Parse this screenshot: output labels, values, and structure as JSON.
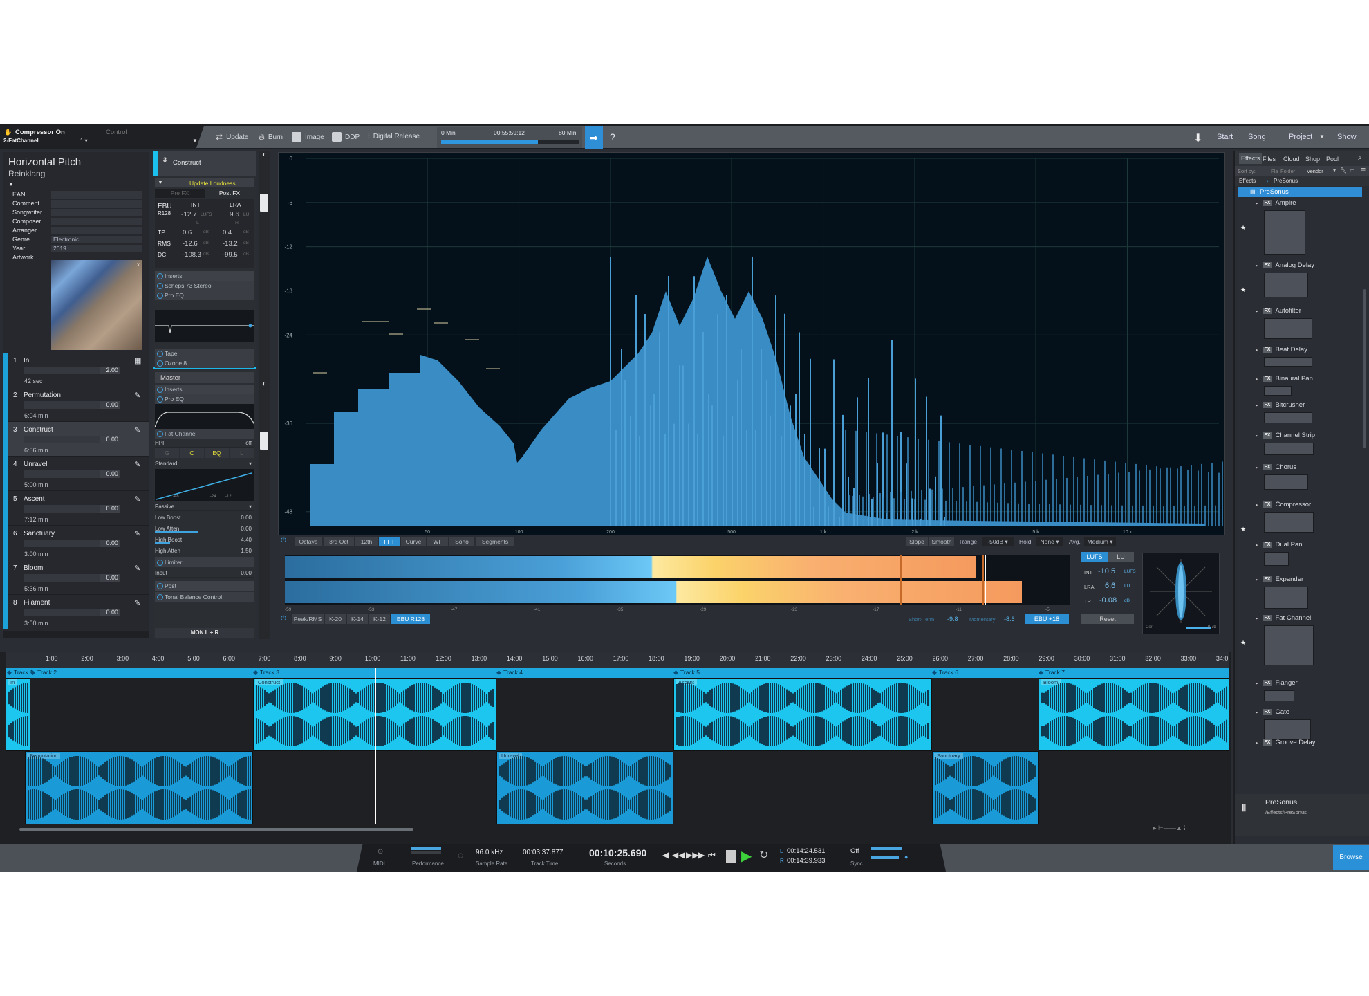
{
  "toolbar": {
    "control_title": "Compressor On",
    "control_channel": "2-FatChannel",
    "control_page": "1 ▾",
    "control_label": "Control",
    "update": "Update",
    "burn": "Burn",
    "image": "Image",
    "ddp": "DDP",
    "digital_release": "Digital Release",
    "duration_min": "0 Min",
    "duration_value": "00:55:59:12",
    "duration_max": "80 Min",
    "duration_fill": 0.7,
    "help": "?",
    "nav": {
      "start": "Start",
      "song": "Song",
      "project": "Project",
      "show": "Show"
    }
  },
  "metadata": {
    "title": "Horizontal Pitch",
    "artist": "Reinklang",
    "fields": [
      {
        "label": "EAN",
        "value": ""
      },
      {
        "label": "Comment",
        "value": ""
      },
      {
        "label": "Songwriter",
        "value": ""
      },
      {
        "label": "Composer",
        "value": ""
      },
      {
        "label": "Arranger",
        "value": ""
      },
      {
        "label": "Genre",
        "value": "Electronic"
      },
      {
        "label": "Year",
        "value": "2019"
      },
      {
        "label": "Artwork",
        "value": ""
      }
    ],
    "artwork_more": "...",
    "artwork_close": "x"
  },
  "tracks": [
    {
      "num": "1",
      "name": "In",
      "gain": "2.00",
      "length": "42 sec"
    },
    {
      "num": "2",
      "name": "Permutation",
      "gain": "0.00",
      "length": "6:04 min"
    },
    {
      "num": "3",
      "name": "Construct",
      "gain": "0.00",
      "length": "6:56 min"
    },
    {
      "num": "4",
      "name": "Unravel",
      "gain": "0.00",
      "length": "5:00 min"
    },
    {
      "num": "5",
      "name": "Ascent",
      "gain": "0.00",
      "length": "7:12 min"
    },
    {
      "num": "6",
      "name": "Sanctuary",
      "gain": "0.00",
      "length": "3:00 min"
    },
    {
      "num": "7",
      "name": "Bloom",
      "gain": "0.00",
      "length": "5:36 min"
    },
    {
      "num": "8",
      "name": "Filament",
      "gain": "0.00",
      "length": "3:50 min"
    }
  ],
  "inspector": {
    "track_num": "3",
    "track_name": "Construct",
    "update_loudness": "Update Loudness",
    "pre_fx": "Pre FX",
    "post_fx": "Post FX",
    "ebu": "EBU",
    "r128": "R128",
    "int_label": "INT",
    "lra_label": "LRA",
    "int_value": "-12.7",
    "int_unit": "LUFS",
    "lra_value": "9.6",
    "lra_unit": "LU",
    "l": "L",
    "r": "R",
    "rows": [
      {
        "label": "TP",
        "l": "0.6",
        "r": "0.4",
        "unit": "dB"
      },
      {
        "label": "RMS",
        "l": "-12.6",
        "r": "-13.2",
        "unit": "dB"
      },
      {
        "label": "DC",
        "l": "-108.3",
        "r": "-99.5",
        "unit": "dB"
      }
    ],
    "inserts_label": "Inserts",
    "track_inserts": [
      "Scheps 73 Stereo",
      "Pro EQ",
      "Tape",
      "Ozone 8"
    ],
    "master_label": "Master",
    "master_inserts": [
      "Pro EQ",
      "Fat Channel"
    ],
    "hpf": "HPF",
    "hpf_value": "off",
    "fc_tabs": [
      "G",
      "C",
      "EQ",
      "L"
    ],
    "comp_mode": "Standard",
    "comp_ticks": [
      "-48",
      "-24",
      "-12"
    ],
    "eq_mode": "Passive",
    "eq_params": [
      {
        "label": "Low Boost",
        "value": "0.00"
      },
      {
        "label": "Low Atten",
        "value": "0.00"
      },
      {
        "label": "High Boost",
        "value": "4.40"
      },
      {
        "label": "High Atten",
        "value": "1.50"
      }
    ],
    "limiter": "Limiter",
    "input_label": "Input",
    "input_value": "0.00",
    "post_label": "Post",
    "post_inserts": [
      "Tonal Balance Control"
    ],
    "mon": "MON L + R"
  },
  "spectrum": {
    "y_ticks": [
      "0",
      "-6",
      "-12",
      "-18",
      "-24",
      "-36",
      "-48"
    ],
    "x_ticks": [
      "50",
      "100",
      "200",
      "500",
      "1 k",
      "2 k",
      "5 k",
      "10 k"
    ],
    "modes": [
      "Octave",
      "3rd Oct",
      "12th",
      "FFT",
      "Curve",
      "WF",
      "Sono",
      "Segments"
    ],
    "active_mode": "FFT",
    "slope": "Slope",
    "smooth": "Smooth",
    "range_label": "Range",
    "range_value": "-50dB",
    "hold_label": "Hold",
    "hold_value": "None",
    "avg_label": "Avg.",
    "avg_value": "Medium"
  },
  "loudness": {
    "scale": [
      "-59",
      "-53",
      "-47",
      "-41",
      "-35",
      "-29",
      "-23",
      "-17",
      "-11",
      "-5"
    ],
    "modes": [
      "Peak/RMS",
      "K-20",
      "K-14",
      "K-12",
      "EBU R128"
    ],
    "active_mode": "EBU R128",
    "short_term_label": "Short-Term",
    "short_term": "-9.8",
    "momentary_label": "Momentary",
    "momentary": "-8.6",
    "ebu_scale": "EBU +18",
    "unit_tabs": [
      "LUFS",
      "LU"
    ],
    "int_label": "INT",
    "int": "-10.5",
    "int_unit": "LUFS",
    "lra_label": "LRA",
    "lra": "6.6",
    "lra_unit": "LU",
    "tp_label": "TP",
    "tp": "-0.08",
    "tp_unit": "dB",
    "reset": "Reset",
    "corr_label": "Cor",
    "corr_value": "0.79"
  },
  "timeline": {
    "ticks": [
      "1:00",
      "2:00",
      "3:00",
      "4:00",
      "5:00",
      "6:00",
      "7:00",
      "8:00",
      "9:00",
      "10:00",
      "11:00",
      "12:00",
      "13:00",
      "14:00",
      "15:00",
      "16:00",
      "17:00",
      "18:00",
      "19:00",
      "20:00",
      "21:00",
      "22:00",
      "23:00",
      "24:00",
      "25:00",
      "26:00",
      "27:00",
      "28:00",
      "29:00",
      "30:00",
      "31:00",
      "32:00",
      "33:00",
      "34:0"
    ],
    "markers": [
      "Track 1",
      "Track 2",
      "Track 3",
      "Track 4",
      "Track 5",
      "Track 6",
      "Track 7"
    ],
    "clips": [
      "In",
      "Permutation",
      "Construct",
      "Unravel",
      "Ascent",
      "Sanctuary",
      "Bloom"
    ]
  },
  "browser": {
    "tabs": [
      "Effects",
      "Files",
      "Cloud",
      "Shop",
      "Pool"
    ],
    "sort_by": "Sort by:",
    "sort_options": [
      "Fla",
      "Folder",
      "Vendor"
    ],
    "breadcrumb": [
      "Effects",
      "PreSonus"
    ],
    "root": "PreSonus",
    "items": [
      "Ampire",
      "Analog Delay",
      "Autofilter",
      "Beat Delay",
      "Binaural Pan",
      "Bitcrusher",
      "Channel Strip",
      "Chorus",
      "Compressor",
      "Dual Pan",
      "Expander",
      "Fat Channel",
      "Flanger",
      "Gate",
      "Groove Delay"
    ],
    "fx_badge": "FX",
    "footer_title": "PreSonus",
    "footer_path": "/Effects/PreSonus",
    "browse": "Browse"
  },
  "transport": {
    "midi": "MIDI",
    "performance": "Performance",
    "sample_rate": "96.0 kHz",
    "sample_rate_label": "Sample Rate",
    "track_time": "00:03:37.877",
    "track_time_label": "Track Time",
    "position": "00:10:25.690",
    "position_label": "Seconds",
    "loop_l": "00:14:24.531",
    "loop_r": "00:14:39.933",
    "l": "L",
    "r": "R",
    "sync": "Off",
    "sync_label": "Sync"
  },
  "colors": {
    "accent": "#2c8fd4",
    "clip": "#1cc6ee",
    "clip_dark": "#1a9ad6",
    "meter_yellow": "#fde27a",
    "meter_orange": "#f7a266"
  }
}
